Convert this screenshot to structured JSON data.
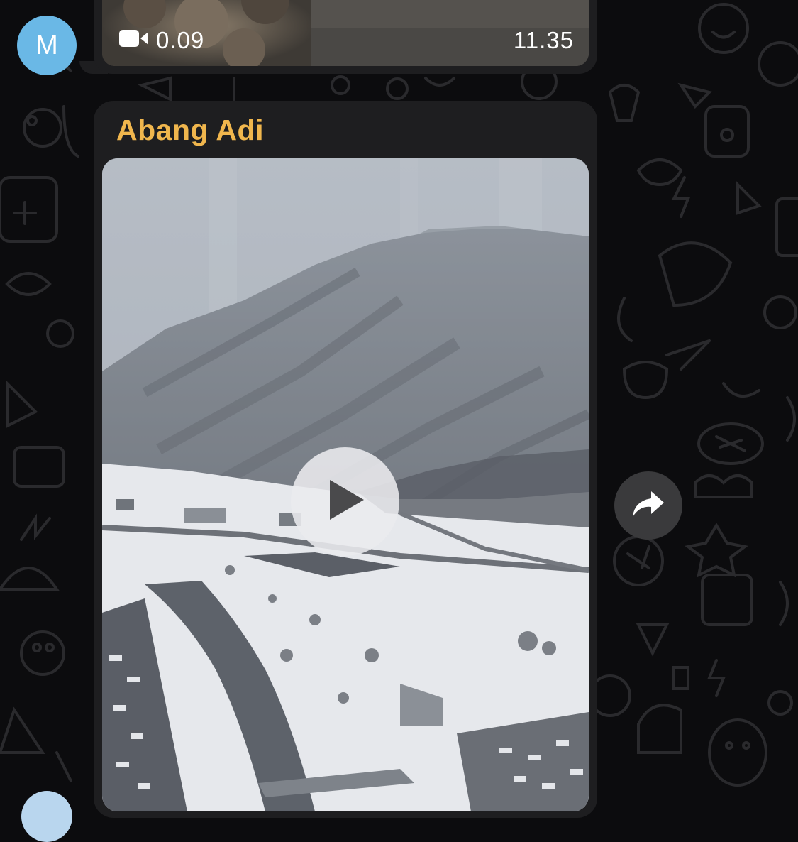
{
  "previous_message": {
    "duration": "0.09",
    "time": "11.35",
    "icon": "video-camera-icon"
  },
  "avatar": {
    "initial": "M",
    "color": "#6ab8e6"
  },
  "message": {
    "sender": "Abang Adi",
    "sender_color": "#f0b64d",
    "media_type": "video",
    "play_icon": "play-icon"
  },
  "actions": {
    "share_icon": "share-arrow-icon"
  },
  "colors": {
    "background": "#0c0c0e",
    "bubble": "#1e1e20"
  }
}
